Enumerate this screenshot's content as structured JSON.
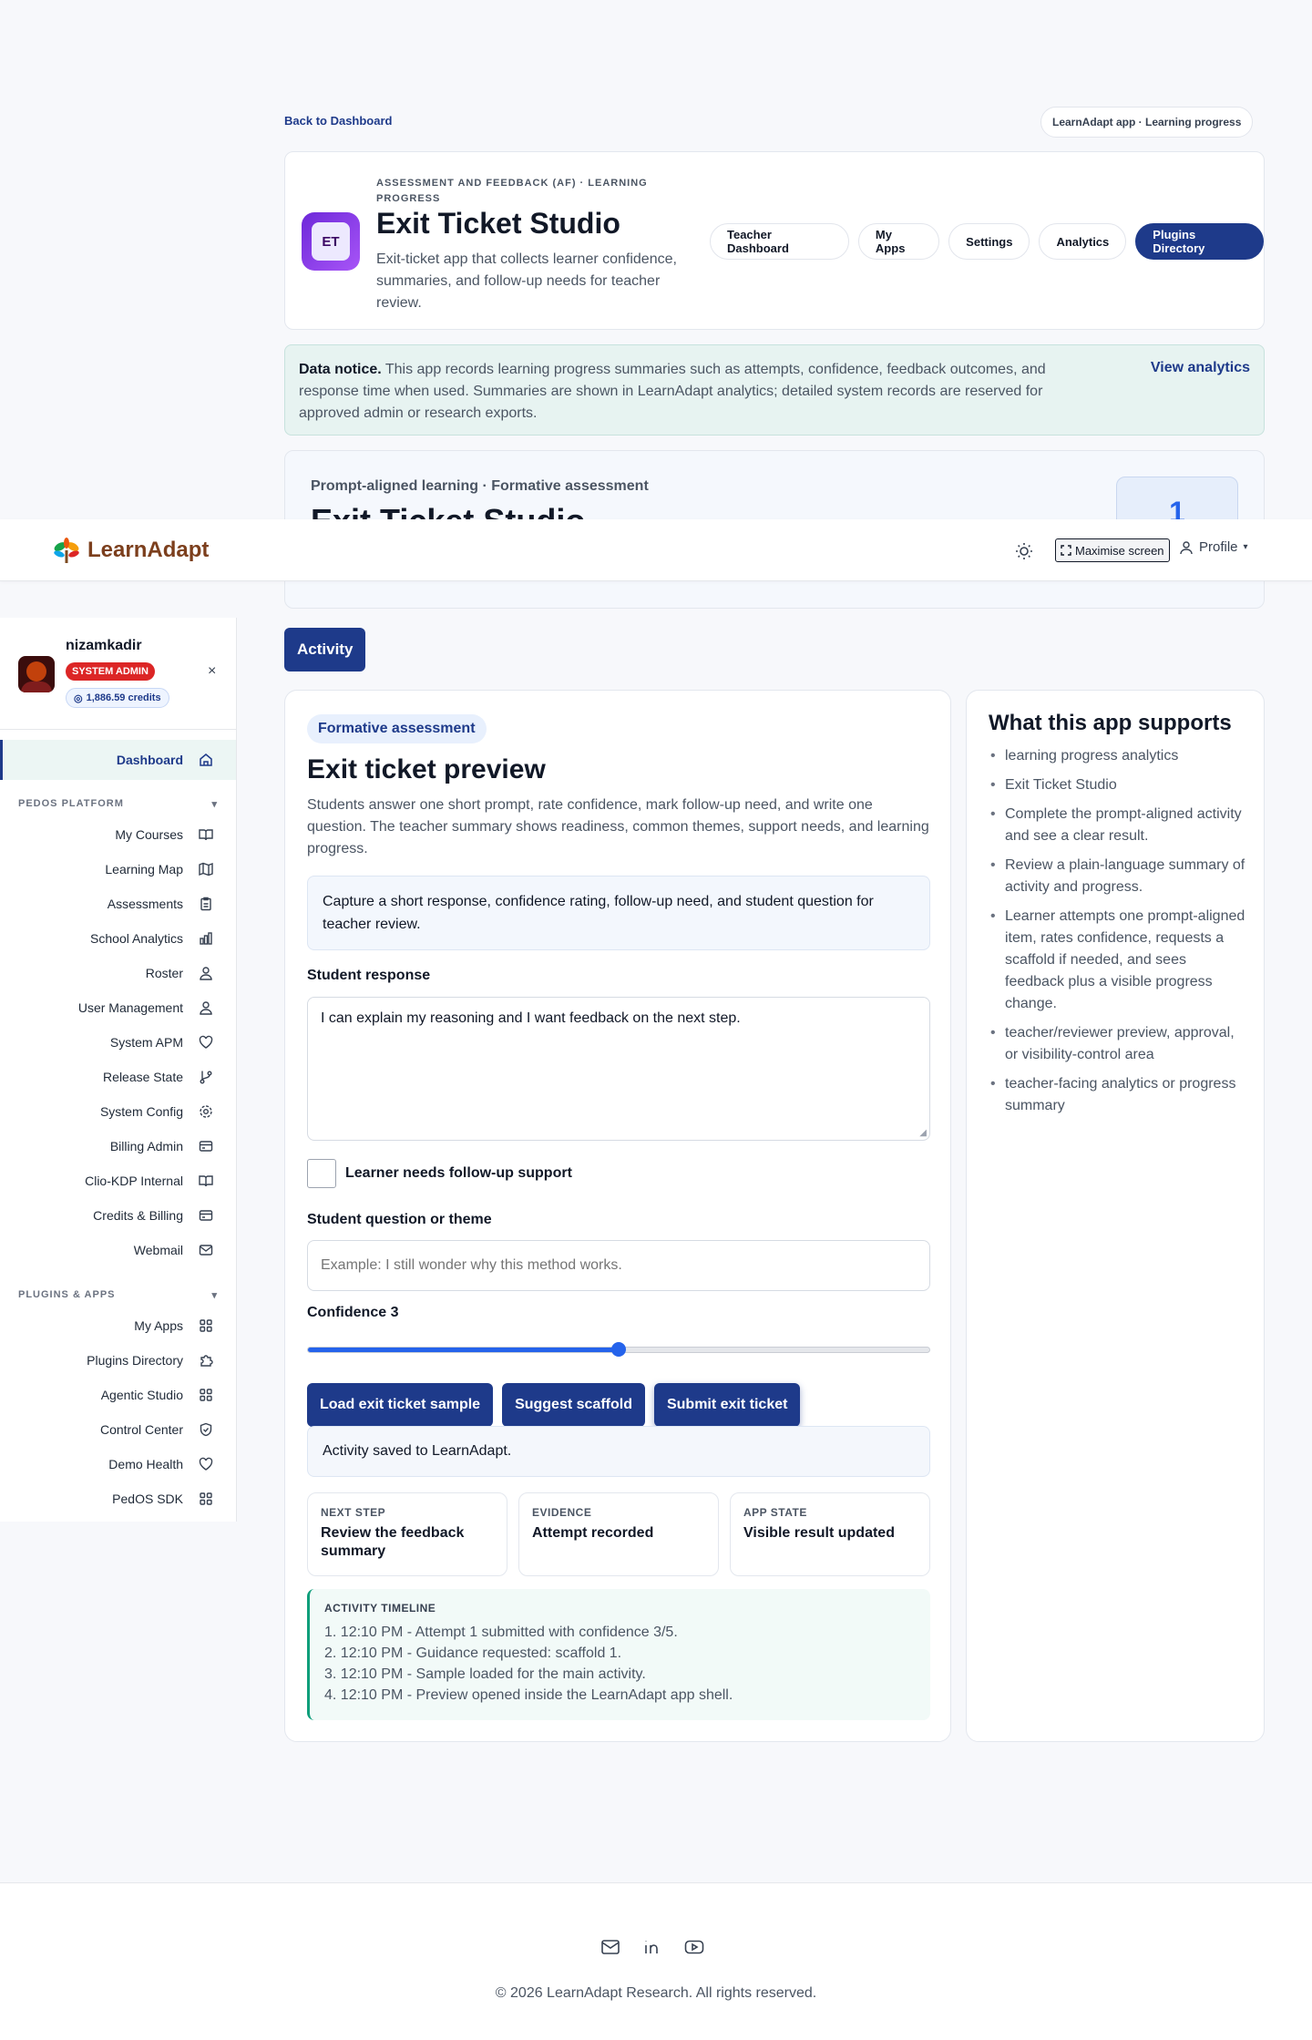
{
  "back_link": "Back to Dashboard",
  "app_tag": "LearnAdapt app · Learning progress",
  "header": {
    "category": "ASSESSMENT AND FEEDBACK (AF) · LEARNING PROGRESS",
    "icon_letters": "ET",
    "title": "Exit Ticket Studio",
    "description": "Exit-ticket app that collects learner confidence, summaries, and follow-up needs for teacher review.",
    "nav": [
      {
        "label": "Teacher Dashboard"
      },
      {
        "label": "My Apps"
      },
      {
        "label": "Settings"
      },
      {
        "label": "Analytics"
      },
      {
        "label": "Plugins Directory"
      }
    ]
  },
  "notice": {
    "strong": "Data notice.",
    "text": "This app records learning progress summaries such as attempts, confidence, feedback outcomes, and response time when used. Summaries are shown in LearnAdapt analytics; detailed system records are reserved for approved admin or research exports.",
    "link": "View analytics"
  },
  "hero": {
    "subtitle": "Prompt-aligned learning · Formative assessment",
    "title": "Exit Ticket Studio",
    "count": "1"
  },
  "topbar": {
    "brand": "LearnAdapt",
    "maximise": "Maximise screen",
    "profile": "Profile"
  },
  "user": {
    "name": "nizamkadir",
    "role": "SYSTEM ADMIN",
    "credits": "1,886.59 credits"
  },
  "sidebar": {
    "dashboard": "Dashboard",
    "section1": "PEDOS PLATFORM",
    "items1": [
      "My Courses",
      "Learning Map",
      "Assessments",
      "School Analytics",
      "Roster",
      "User Management",
      "System APM",
      "Release State",
      "System Config",
      "Billing Admin",
      "Clio-KDP Internal",
      "Credits & Billing",
      "Webmail"
    ],
    "section2": "PLUGINS & APPS",
    "items2": [
      "My Apps",
      "Plugins Directory",
      "Agentic Studio",
      "Control Center",
      "Demo Health",
      "PedOS SDK"
    ]
  },
  "activity_tab": "Activity",
  "main": {
    "badge": "Formative assessment",
    "title": "Exit ticket preview",
    "description": "Students answer one short prompt, rate confidence, mark follow-up need, and write one question. The teacher summary shows readiness, common themes, support needs, and learning progress.",
    "prompt": "Capture a short response, confidence rating, follow-up need, and student question for teacher review.",
    "response_label": "Student response",
    "response_value": "I can explain my reasoning and I want feedback on the next step.",
    "followup_label": "Learner needs follow-up support",
    "question_label": "Student question or theme",
    "question_placeholder": "Example: I still wonder why this method works.",
    "confidence_label": "Confidence 3",
    "confidence_value": 3,
    "confidence_max": 5,
    "buttons": {
      "load": "Load exit ticket sample",
      "suggest": "Suggest scaffold",
      "submit": "Submit exit ticket"
    },
    "status_msg": "Activity saved to LearnAdapt.",
    "cards": [
      {
        "label": "NEXT STEP",
        "value": "Review the feedback summary"
      },
      {
        "label": "EVIDENCE",
        "value": "Attempt recorded"
      },
      {
        "label": "APP STATE",
        "value": "Visible result updated"
      }
    ],
    "timeline_label": "ACTIVITY TIMELINE",
    "timeline": [
      "1. 12:10 PM - Attempt 1 submitted with confidence 3/5.",
      "2. 12:10 PM - Guidance requested: scaffold 1.",
      "3. 12:10 PM - Sample loaded for the main activity.",
      "4. 12:10 PM - Preview opened inside the LearnAdapt app shell."
    ]
  },
  "supports": {
    "title": "What this app supports",
    "items": [
      "learning progress analytics",
      "Exit Ticket Studio",
      "Complete the prompt-aligned activity and see a clear result.",
      "Review a plain-language summary of activity and progress.",
      "Learner attempts one prompt-aligned item, rates confidence, requests a scaffold if needed, and sees feedback plus a visible progress change.",
      "teacher/reviewer preview, approval, or visibility-control area",
      "teacher-facing analytics or progress summary"
    ]
  },
  "footer": {
    "copyright": "© 2026 LearnAdapt Research. All rights reserved."
  }
}
